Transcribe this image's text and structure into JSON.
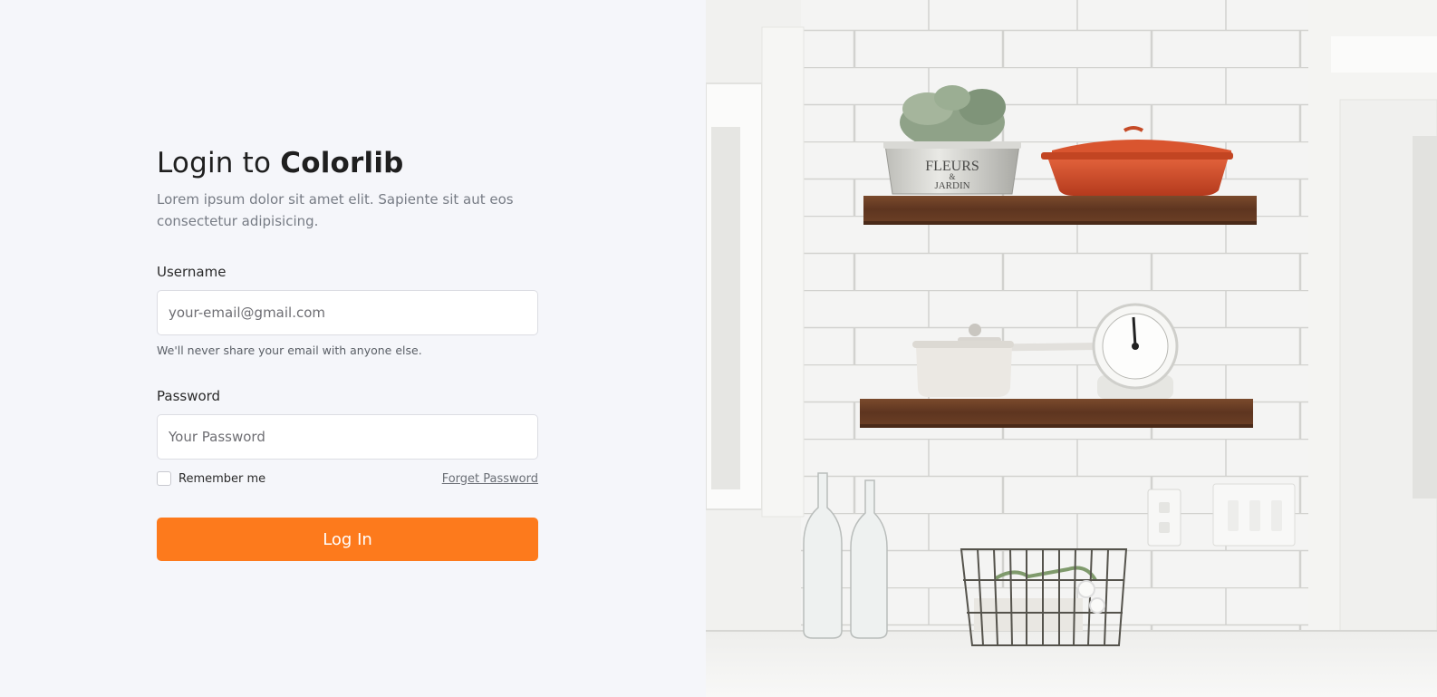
{
  "login": {
    "title_prefix": "Login to ",
    "title_brand": "Colorlib",
    "subtitle": "Lorem ipsum dolor sit amet elit. Sapiente sit aut eos consectetur adipisicing.",
    "username_label": "Username",
    "username_placeholder": "your-email@gmail.com",
    "username_help": "We'll never share your email with anyone else.",
    "password_label": "Password",
    "password_placeholder": "Your Password",
    "remember_label": "Remember me",
    "forget_label": "Forget Password",
    "login_button": "Log In"
  },
  "photo": {
    "pot_text_1": "FLEURS",
    "pot_text_2": "&",
    "pot_text_3": "JARDIN"
  },
  "colors": {
    "accent": "#fd7a1c",
    "background": "#f5f6fa"
  }
}
